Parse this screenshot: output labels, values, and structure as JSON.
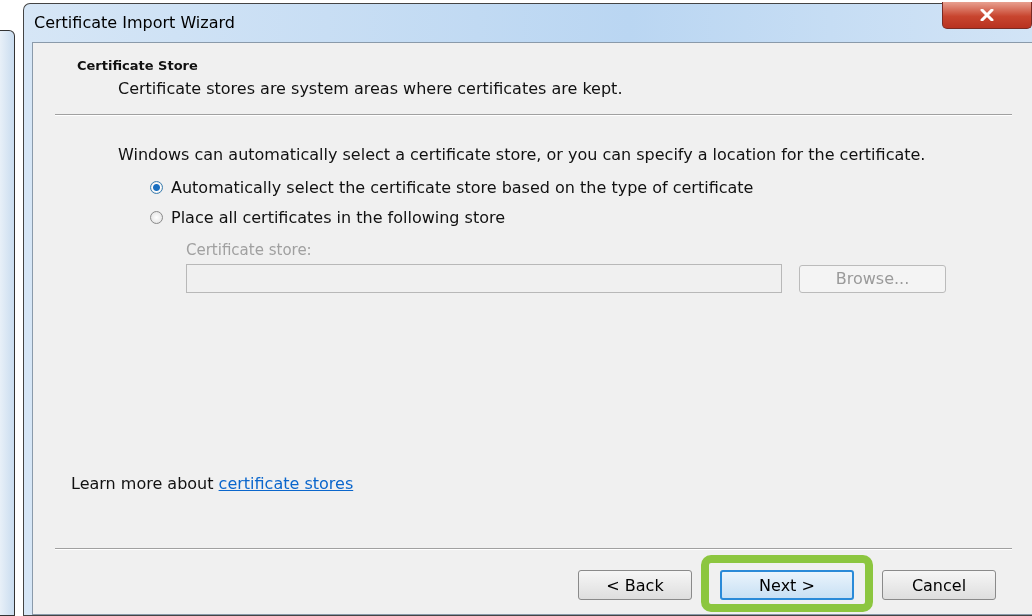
{
  "window": {
    "title": "Certificate Import Wizard"
  },
  "header": {
    "title": "Certificate Store",
    "subtitle": "Certificate stores are system areas where certificates are kept."
  },
  "intro": "Windows can automatically select a certificate store, or you can specify a location for the certificate.",
  "options": [
    {
      "label": "Automatically select the certificate store based on the type of certificate",
      "selected": true
    },
    {
      "label": "Place all certificates in the following store",
      "selected": false
    }
  ],
  "store_field": {
    "label": "Certificate store:",
    "disabled": true
  },
  "browse_button": {
    "label": "Browse...",
    "disabled": true
  },
  "learn_more": {
    "text": "Learn more about ",
    "link": "certificate stores"
  },
  "buttons": [
    {
      "label": "< Back",
      "default": false,
      "highlighted": false
    },
    {
      "label": "Next >",
      "default": true,
      "highlighted": true
    },
    {
      "label": "Cancel",
      "default": false,
      "highlighted": false
    }
  ]
}
